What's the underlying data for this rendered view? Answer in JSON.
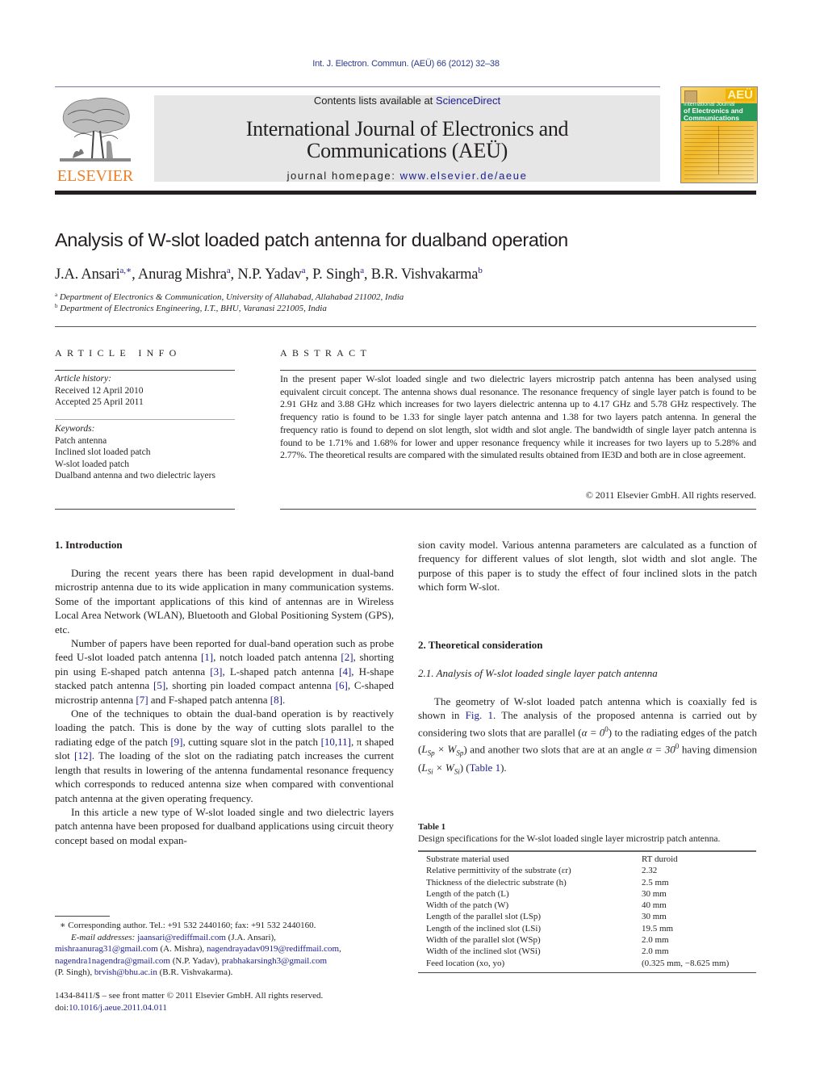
{
  "header": {
    "journal_ref": "Int. J. Electron. Commun. (AEÜ) 66 (2012) 32–38",
    "publisher_logo_text": "ELSEVIER",
    "contents_prefix": "Contents lists available at ",
    "contents_link": "ScienceDirect",
    "journal_title_line1": "International Journal of Electronics and",
    "journal_title_line2": "Communications (AEÜ)",
    "homepage_prefix": "journal homepage: ",
    "homepage_link": "www.elsevier.de/aeue",
    "cover": {
      "badge": "AEÜ",
      "line1": "International Journal",
      "line2": "of Electronics and",
      "line3": "Communications"
    }
  },
  "article": {
    "title": "Analysis of W-slot loaded patch antenna for dualband operation",
    "authors": [
      {
        "name": "J.A. Ansari",
        "sup": "a,∗"
      },
      {
        "name": "Anurag Mishra",
        "sup": "a"
      },
      {
        "name": "N.P. Yadav",
        "sup": "a"
      },
      {
        "name": "P. Singh",
        "sup": "a"
      },
      {
        "name": "B.R. Vishvakarma",
        "sup": "b"
      }
    ],
    "affiliations": [
      {
        "mark": "a",
        "text": "Department of Electronics & Communication, University of Allahabad, Allahabad 211002, India"
      },
      {
        "mark": "b",
        "text": "Department of Electronics Engineering, I.T., BHU, Varanasi 221005, India"
      }
    ]
  },
  "article_info": {
    "heading": "ARTICLE INFO",
    "history_label": "Article history:",
    "received": "Received 12 April 2010",
    "accepted": "Accepted 25 April 2011",
    "keywords_label": "Keywords:",
    "keywords": [
      "Patch antenna",
      "Inclined slot loaded patch",
      "W-slot loaded patch",
      "Dualband antenna and two dielectric layers"
    ]
  },
  "abstract": {
    "heading": "ABSTRACT",
    "text": "In the present paper W-slot loaded single and two dielectric layers microstrip patch antenna has been analysed using equivalent circuit concept. The antenna shows dual resonance. The resonance frequency of single layer patch is found to be 2.91 GHz and 3.88 GHz which increases for two layers dielectric antenna up to 4.17 GHz and 5.78 GHz respectively. The frequency ratio is found to be 1.33 for single layer patch antenna and 1.38 for two layers patch antenna. In general the frequency ratio is found to depend on slot length, slot width and slot angle. The bandwidth of single layer patch antenna is found to be 1.71% and 1.68% for lower and upper resonance frequency while it increases for two layers up to 5.28% and 2.77%. The theoretical results are compared with the simulated results obtained from IE3D and both are in close agreement.",
    "copyright": "© 2011 Elsevier GmbH. All rights reserved."
  },
  "intro": {
    "heading": "1.  Introduction",
    "p1": "During the recent years there has been rapid development in dual-band microstrip antenna due to its wide application in many communication systems. Some of the important applications of this kind of antennas are in Wireless Local Area Network (WLAN), Bluetooth and Global Positioning System (GPS), etc.",
    "p2": {
      "t0": "Number of papers have been reported for dual-band operation such as probe feed U-slot loaded patch antenna ",
      "r1": "[1]",
      "t1": ", notch loaded patch antenna ",
      "r2": "[2]",
      "t2": ", shorting pin using E-shaped patch antenna ",
      "r3": "[3]",
      "t3": ", L-shaped patch antenna ",
      "r4": "[4]",
      "t4": ", H-shape stacked patch antenna ",
      "r5": "[5]",
      "t5": ", shorting pin loaded compact antenna ",
      "r6": "[6]",
      "t6": ", C-shaped microstrip antenna ",
      "r7": "[7]",
      "t7": " and F-shaped patch antenna ",
      "r8": "[8]",
      "t8": "."
    },
    "p3": {
      "t0": "One of the techniques to obtain the dual-band operation is by reactively loading the patch. This is done by the way of cutting slots parallel to the radiating edge of the patch ",
      "r9": "[9]",
      "t1": ", cutting square slot in the patch ",
      "r10": "[10,11]",
      "t2": ", π shaped slot ",
      "r12": "[12]",
      "t3": ". The loading of the slot on the radiating patch increases the current length that results in lowering of the antenna fundamental resonance frequency which corresponds to reduced antenna size when compared with conventional patch antenna at the given operating frequency."
    },
    "p4": "In this article a new type of W-slot loaded single and two dielectric layers patch antenna have been proposed for dualband applications using circuit theory concept based on modal expan-",
    "p4_cont": "sion cavity model. Various antenna parameters are calculated as a function of frequency for different values of slot length, slot width and slot angle. The purpose of this paper is to study the effect of four inclined slots in the patch which form W-slot."
  },
  "theory": {
    "heading": "2.  Theoretical consideration",
    "sub_heading": "2.1.  Analysis of W-slot loaded single layer patch antenna",
    "p1": {
      "t0": "The geometry of W-slot loaded patch antenna which is coaxially fed is shown in ",
      "fig_ref": "Fig. 1",
      "t1": ". The analysis of the proposed antenna is carried out by considering two slots that are parallel (",
      "alpha0": "α = 0",
      "t2": ") to the radiating edges of the patch (",
      "dim1": "L",
      "t3": ") and another two slots that are at an angle ",
      "alpha30": "α = 30",
      "t4": " having dimension (",
      "t5": ") (",
      "table_ref": "Table 1",
      "t6": ")."
    }
  },
  "table1": {
    "label": "Table 1",
    "caption": "Design specifications for the W-slot loaded single layer microstrip patch antenna.",
    "rows": [
      {
        "param": "Substrate material used",
        "value": "RT duroid"
      },
      {
        "param": "Relative permittivity of the substrate (εr)",
        "value": "2.32"
      },
      {
        "param": "Thickness of the dielectric substrate (h)",
        "value": "2.5 mm"
      },
      {
        "param": "Length of the patch (L)",
        "value": "30 mm"
      },
      {
        "param": "Width of the patch (W)",
        "value": "40 mm"
      },
      {
        "param": "Length of the parallel slot (LSp)",
        "value": "30 mm"
      },
      {
        "param": "Length of the inclined slot (LSi)",
        "value": "19.5 mm"
      },
      {
        "param": "Width of the parallel slot (WSp)",
        "value": "2.0 mm"
      },
      {
        "param": "Width of the inclined slot (WSi)",
        "value": "2.0 mm"
      },
      {
        "param": "Feed location (xo, yo)",
        "value": "(0.325 mm, −8.625 mm)"
      }
    ]
  },
  "footnote": {
    "star": "∗",
    "corresponding": " Corresponding author. Tel.: +91 532 2440160; fax: +91 532 2440160.",
    "email_label": "E-mail addresses:",
    "emails": [
      {
        "addr": "jaansari@rediffmail.com",
        "who": " (J.A. Ansari),"
      },
      {
        "addr": "mishraanurag31@gmail.com",
        "who": " (A. Mishra), "
      },
      {
        "addr": "nagendrayadav0919@rediffmail.com",
        "who": ","
      },
      {
        "addr": "nagendra1nagendra@gmail.com",
        "who": " (N.P. Yadav), "
      },
      {
        "addr": "prabhakarsingh3@gmail.com",
        "who": ""
      },
      {
        "addr": "brvish@bhu.ac.in",
        "who": " (B.R. Vishvakarma)."
      }
    ],
    "singh_prefix": "(P. Singh), "
  },
  "front_matter": {
    "issn_line": "1434-8411/$ – see front matter © 2011 Elsevier GmbH. All rights reserved.",
    "doi_prefix": "doi:",
    "doi": "10.1016/j.aeue.2011.04.011"
  }
}
